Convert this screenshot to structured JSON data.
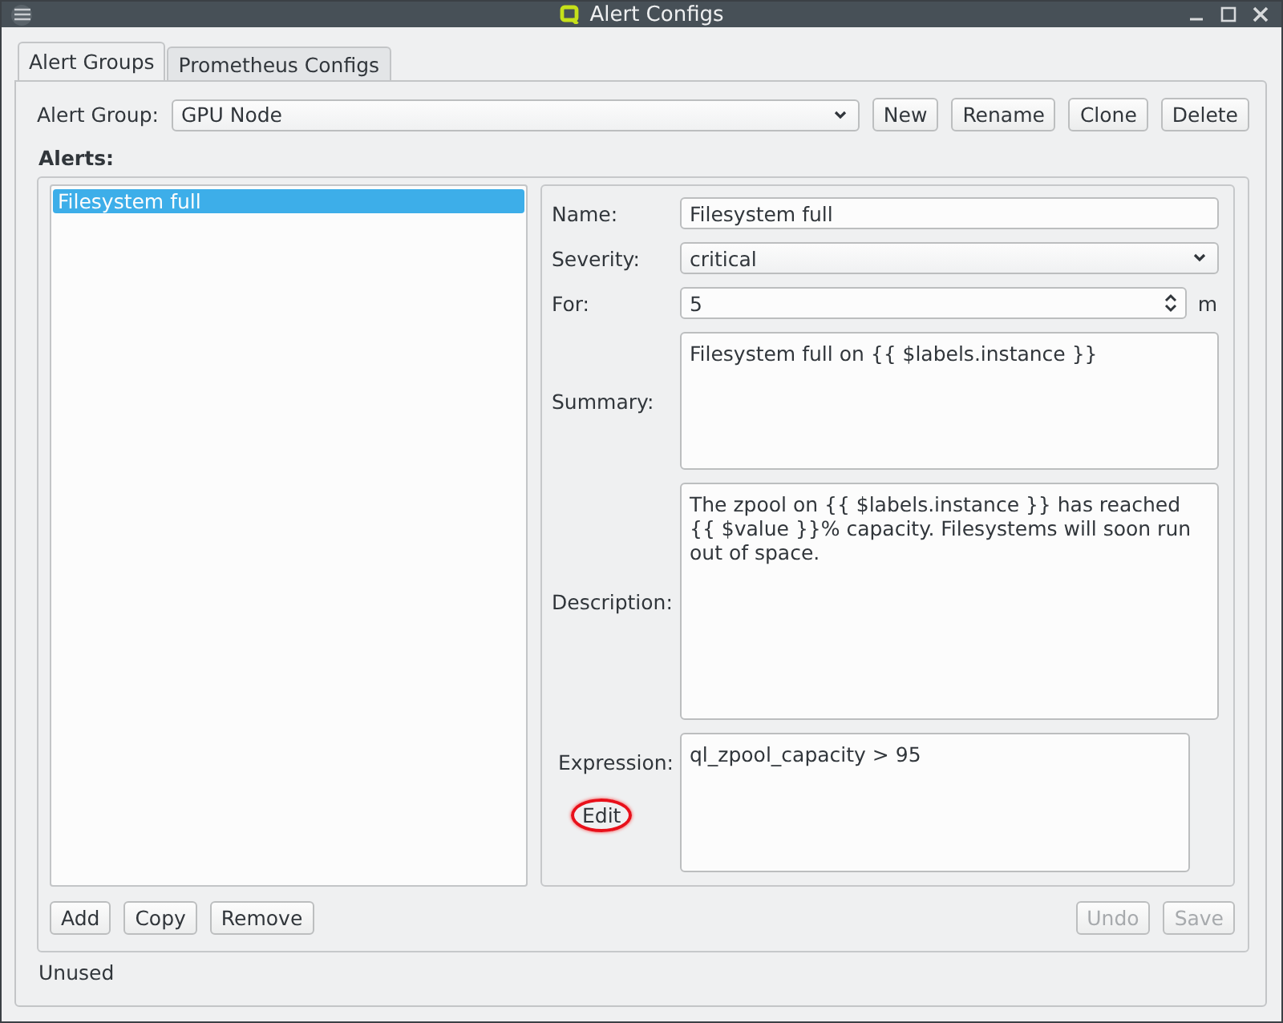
{
  "window": {
    "title": "Alert Configs"
  },
  "tabs": [
    {
      "label": "Alert Groups",
      "selected": true
    },
    {
      "label": "Prometheus Configs",
      "selected": false
    }
  ],
  "alert_group": {
    "label": "Alert Group:",
    "value": "GPU Node",
    "buttons": [
      "New",
      "Rename",
      "Clone",
      "Delete"
    ]
  },
  "alerts": {
    "label": "Alerts:",
    "items": [
      {
        "label": "Filesystem full",
        "selected": true
      }
    ],
    "buttons": [
      "Add",
      "Copy",
      "Remove"
    ]
  },
  "form": {
    "name": {
      "label": "Name:",
      "value": "Filesystem full"
    },
    "severity": {
      "label": "Severity:",
      "value": "critical"
    },
    "for": {
      "label": "For:",
      "value": "5",
      "unit": "m"
    },
    "summary": {
      "label": "Summary:",
      "value": "Filesystem full on {{ $labels.instance }}"
    },
    "description": {
      "label": "Description:",
      "value": "The zpool on {{ $labels.instance }} has reached {{ $value }}% capacity. Filesystems will soon run out of space."
    },
    "expression": {
      "label": "Expression:",
      "value": "ql_zpool_capacity > 95"
    },
    "edit": {
      "label": "Edit",
      "highlighted": true
    }
  },
  "actions": [
    {
      "label": "Undo",
      "disabled": true
    },
    {
      "label": "Save",
      "disabled": true
    }
  ],
  "status": "Unused"
}
